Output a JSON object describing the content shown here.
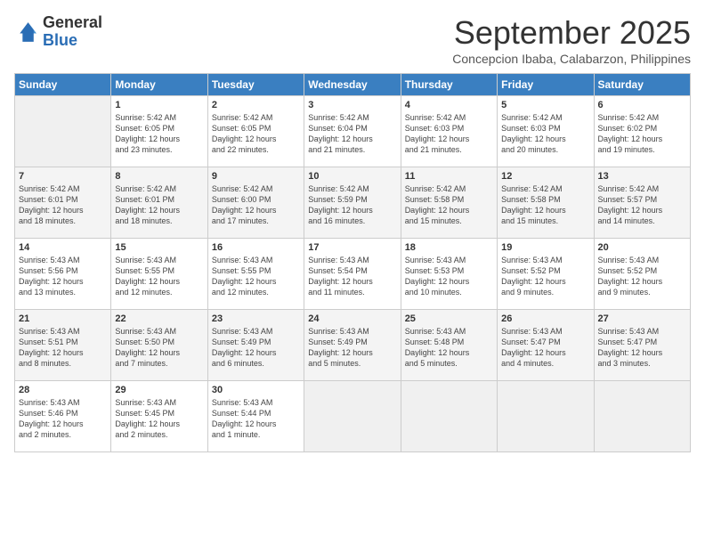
{
  "logo": {
    "general": "General",
    "blue": "Blue"
  },
  "title": "September 2025",
  "subtitle": "Concepcion Ibaba, Calabarzon, Philippines",
  "days": [
    "Sunday",
    "Monday",
    "Tuesday",
    "Wednesday",
    "Thursday",
    "Friday",
    "Saturday"
  ],
  "weeks": [
    [
      {
        "day": "",
        "content": ""
      },
      {
        "day": "1",
        "content": "Sunrise: 5:42 AM\nSunset: 6:05 PM\nDaylight: 12 hours\nand 23 minutes."
      },
      {
        "day": "2",
        "content": "Sunrise: 5:42 AM\nSunset: 6:05 PM\nDaylight: 12 hours\nand 22 minutes."
      },
      {
        "day": "3",
        "content": "Sunrise: 5:42 AM\nSunset: 6:04 PM\nDaylight: 12 hours\nand 21 minutes."
      },
      {
        "day": "4",
        "content": "Sunrise: 5:42 AM\nSunset: 6:03 PM\nDaylight: 12 hours\nand 21 minutes."
      },
      {
        "day": "5",
        "content": "Sunrise: 5:42 AM\nSunset: 6:03 PM\nDaylight: 12 hours\nand 20 minutes."
      },
      {
        "day": "6",
        "content": "Sunrise: 5:42 AM\nSunset: 6:02 PM\nDaylight: 12 hours\nand 19 minutes."
      }
    ],
    [
      {
        "day": "7",
        "content": "Sunrise: 5:42 AM\nSunset: 6:01 PM\nDaylight: 12 hours\nand 18 minutes."
      },
      {
        "day": "8",
        "content": "Sunrise: 5:42 AM\nSunset: 6:01 PM\nDaylight: 12 hours\nand 18 minutes."
      },
      {
        "day": "9",
        "content": "Sunrise: 5:42 AM\nSunset: 6:00 PM\nDaylight: 12 hours\nand 17 minutes."
      },
      {
        "day": "10",
        "content": "Sunrise: 5:42 AM\nSunset: 5:59 PM\nDaylight: 12 hours\nand 16 minutes."
      },
      {
        "day": "11",
        "content": "Sunrise: 5:42 AM\nSunset: 5:58 PM\nDaylight: 12 hours\nand 15 minutes."
      },
      {
        "day": "12",
        "content": "Sunrise: 5:42 AM\nSunset: 5:58 PM\nDaylight: 12 hours\nand 15 minutes."
      },
      {
        "day": "13",
        "content": "Sunrise: 5:42 AM\nSunset: 5:57 PM\nDaylight: 12 hours\nand 14 minutes."
      }
    ],
    [
      {
        "day": "14",
        "content": "Sunrise: 5:43 AM\nSunset: 5:56 PM\nDaylight: 12 hours\nand 13 minutes."
      },
      {
        "day": "15",
        "content": "Sunrise: 5:43 AM\nSunset: 5:55 PM\nDaylight: 12 hours\nand 12 minutes."
      },
      {
        "day": "16",
        "content": "Sunrise: 5:43 AM\nSunset: 5:55 PM\nDaylight: 12 hours\nand 12 minutes."
      },
      {
        "day": "17",
        "content": "Sunrise: 5:43 AM\nSunset: 5:54 PM\nDaylight: 12 hours\nand 11 minutes."
      },
      {
        "day": "18",
        "content": "Sunrise: 5:43 AM\nSunset: 5:53 PM\nDaylight: 12 hours\nand 10 minutes."
      },
      {
        "day": "19",
        "content": "Sunrise: 5:43 AM\nSunset: 5:52 PM\nDaylight: 12 hours\nand 9 minutes."
      },
      {
        "day": "20",
        "content": "Sunrise: 5:43 AM\nSunset: 5:52 PM\nDaylight: 12 hours\nand 9 minutes."
      }
    ],
    [
      {
        "day": "21",
        "content": "Sunrise: 5:43 AM\nSunset: 5:51 PM\nDaylight: 12 hours\nand 8 minutes."
      },
      {
        "day": "22",
        "content": "Sunrise: 5:43 AM\nSunset: 5:50 PM\nDaylight: 12 hours\nand 7 minutes."
      },
      {
        "day": "23",
        "content": "Sunrise: 5:43 AM\nSunset: 5:49 PM\nDaylight: 12 hours\nand 6 minutes."
      },
      {
        "day": "24",
        "content": "Sunrise: 5:43 AM\nSunset: 5:49 PM\nDaylight: 12 hours\nand 5 minutes."
      },
      {
        "day": "25",
        "content": "Sunrise: 5:43 AM\nSunset: 5:48 PM\nDaylight: 12 hours\nand 5 minutes."
      },
      {
        "day": "26",
        "content": "Sunrise: 5:43 AM\nSunset: 5:47 PM\nDaylight: 12 hours\nand 4 minutes."
      },
      {
        "day": "27",
        "content": "Sunrise: 5:43 AM\nSunset: 5:47 PM\nDaylight: 12 hours\nand 3 minutes."
      }
    ],
    [
      {
        "day": "28",
        "content": "Sunrise: 5:43 AM\nSunset: 5:46 PM\nDaylight: 12 hours\nand 2 minutes."
      },
      {
        "day": "29",
        "content": "Sunrise: 5:43 AM\nSunset: 5:45 PM\nDaylight: 12 hours\nand 2 minutes."
      },
      {
        "day": "30",
        "content": "Sunrise: 5:43 AM\nSunset: 5:44 PM\nDaylight: 12 hours\nand 1 minute."
      },
      {
        "day": "",
        "content": ""
      },
      {
        "day": "",
        "content": ""
      },
      {
        "day": "",
        "content": ""
      },
      {
        "day": "",
        "content": ""
      }
    ]
  ]
}
